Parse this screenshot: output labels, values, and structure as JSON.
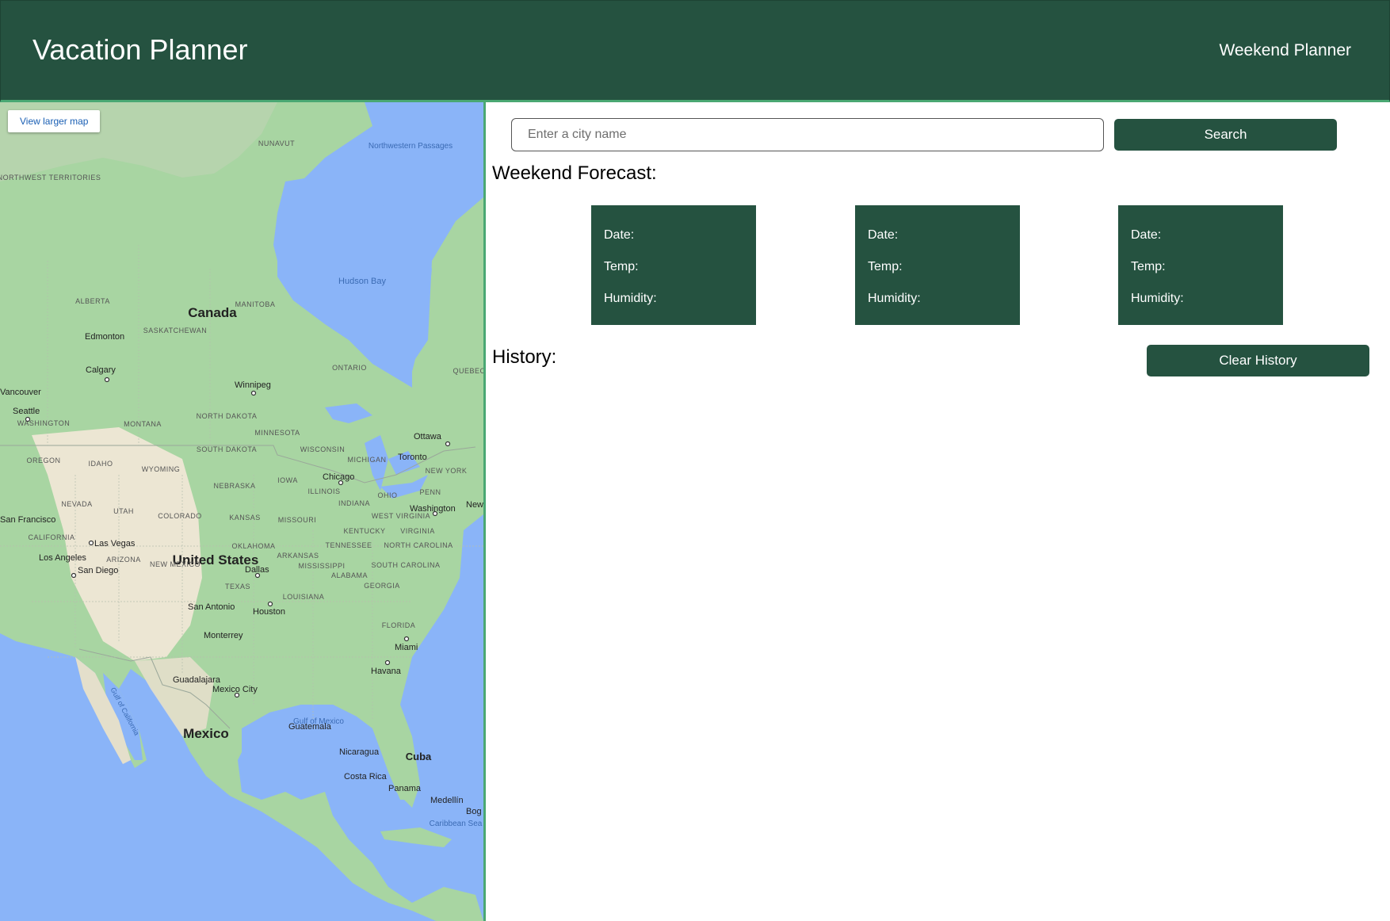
{
  "header": {
    "title": "Vacation Planner",
    "nav_link": "Weekend Planner"
  },
  "map": {
    "view_larger_label": "View larger map",
    "labels": {
      "canada": "Canada",
      "united_states": "United States",
      "mexico": "Mexico",
      "cuba": "Cuba",
      "hudson_bay": "Hudson Bay",
      "gulf_of_mexico": "Gulf of Mexico",
      "gulf_of_california": "Gulf of California",
      "caribbean_sea": "Caribbean Sea",
      "northwestern_passages": "Northwestern Passages",
      "nunavut": "NUNAVUT",
      "northwest_territories": "NORTHWEST TERRITORIES",
      "alberta": "ALBERTA",
      "saskatchewan": "SASKATCHEWAN",
      "manitoba": "MANITOBA",
      "ontario": "ONTARIO",
      "quebec": "QUEBEC",
      "edmonton": "Edmonton",
      "calgary": "Calgary",
      "vancouver": "Vancouver",
      "winnipeg": "Winnipeg",
      "seattle": "Seattle",
      "washington_state": "WASHINGTON",
      "oregon": "OREGON",
      "idaho": "IDAHO",
      "montana": "MONTANA",
      "wyoming": "WYOMING",
      "north_dakota": "NORTH DAKOTA",
      "south_dakota": "SOUTH DAKOTA",
      "minnesota": "MINNESOTA",
      "wisconsin": "WISCONSIN",
      "michigan": "MICHIGAN",
      "nebraska": "NEBRASKA",
      "iowa": "IOWA",
      "illinois": "ILLINOIS",
      "indiana": "INDIANA",
      "ohio": "OHIO",
      "penn": "PENN",
      "new_york": "NEW YORK",
      "nevada": "NEVADA",
      "utah": "UTAH",
      "colorado": "COLORADO",
      "kansas": "KANSAS",
      "missouri": "MISSOURI",
      "california": "CALIFORNIA",
      "arizona": "ARIZONA",
      "new_mexico": "NEW MEXICO",
      "oklahoma": "OKLAHOMA",
      "texas": "TEXAS",
      "arkansas": "ARKANSAS",
      "tennessee": "TENNESSEE",
      "kentucky": "KENTUCKY",
      "west_virginia": "WEST VIRGINIA",
      "virginia": "VIRGINIA",
      "north_carolina": "NORTH CAROLINA",
      "south_carolina": "SOUTH CAROLINA",
      "mississippi": "MISSISSIPPI",
      "alabama": "ALABAMA",
      "georgia": "GEORGIA",
      "louisiana": "LOUISIANA",
      "florida": "FLORIDA",
      "chicago": "Chicago",
      "toronto": "Toronto",
      "ottawa": "Ottawa",
      "washington_dc": "Washington",
      "new_york_city": "New",
      "san_francisco": "San Francisco",
      "las_vegas": "Las Vegas",
      "los_angeles": "Los Angeles",
      "san_diego": "San Diego",
      "dallas": "Dallas",
      "houston": "Houston",
      "san_antonio": "San Antonio",
      "monterrey": "Monterrey",
      "miami": "Miami",
      "havana": "Havana",
      "guadalajara": "Guadalajara",
      "mexico_city": "Mexico City",
      "guatemala": "Guatemala",
      "nicaragua": "Nicaragua",
      "costa_rica": "Costa Rica",
      "panama": "Panama",
      "medellin": "Medellín",
      "bogota": "Bog"
    }
  },
  "search": {
    "placeholder": "Enter a city name",
    "button_label": "Search"
  },
  "forecast": {
    "title": "Weekend Forecast:",
    "cards": [
      {
        "date_label": "Date:",
        "temp_label": "Temp:",
        "humidity_label": "Humidity:"
      },
      {
        "date_label": "Date:",
        "temp_label": "Temp:",
        "humidity_label": "Humidity:"
      },
      {
        "date_label": "Date:",
        "temp_label": "Temp:",
        "humidity_label": "Humidity:"
      }
    ]
  },
  "history": {
    "title": "History:",
    "clear_button_label": "Clear History"
  },
  "colors": {
    "primary": "#255240",
    "accent_border": "#4aa873",
    "water": "#8ab4f8",
    "land": "#a8d5a2"
  }
}
